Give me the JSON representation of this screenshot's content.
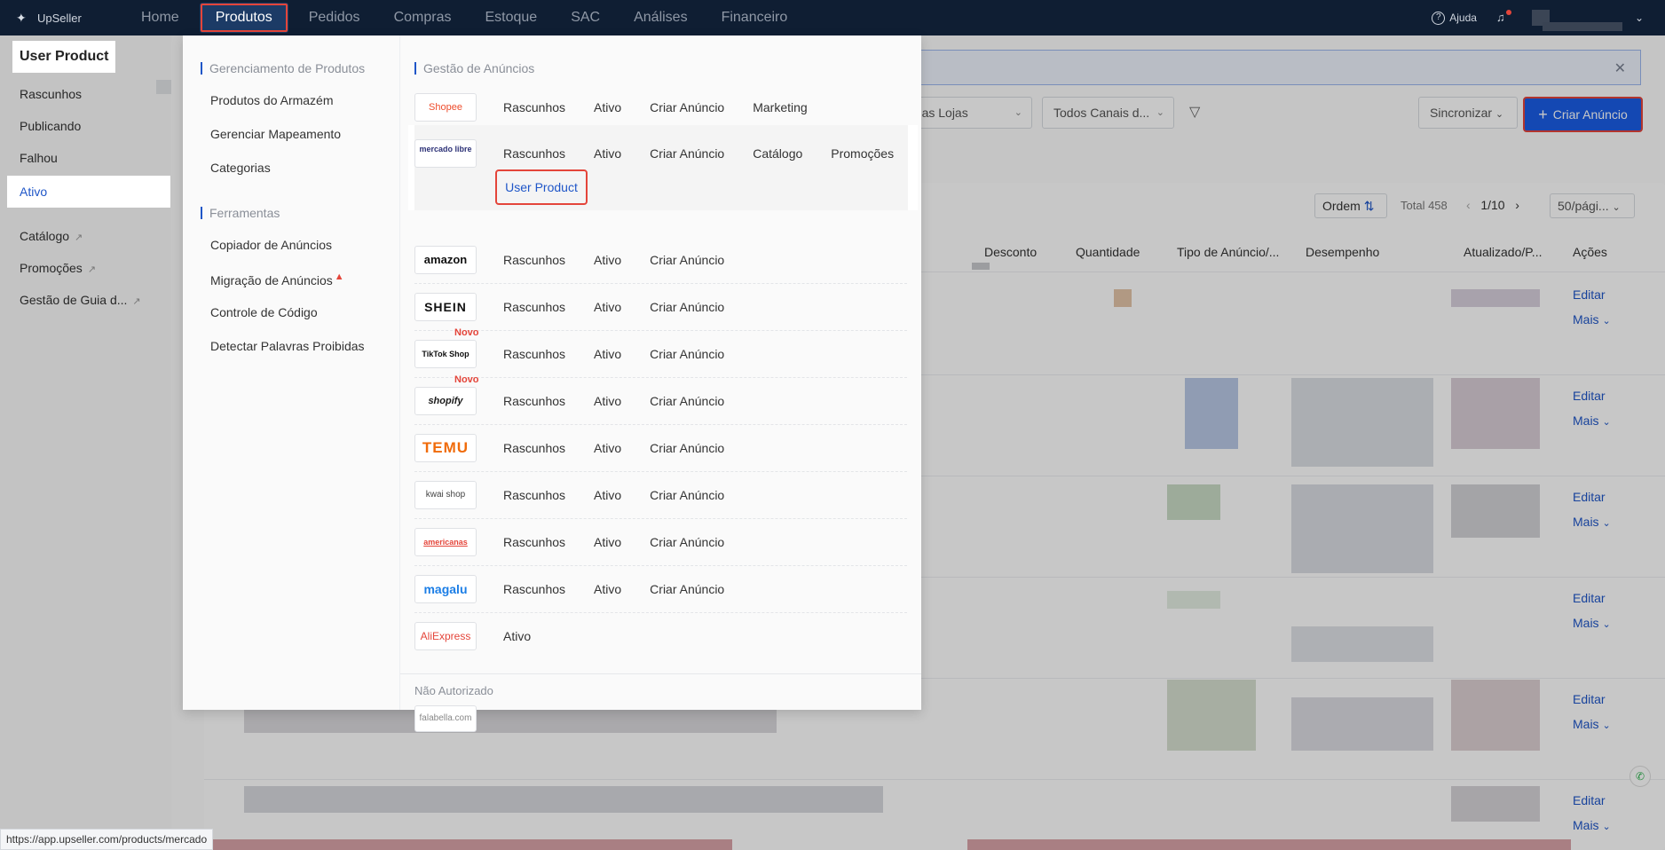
{
  "topbar": {
    "logo": "UpSeller",
    "nav": [
      "Home",
      "Produtos",
      "Pedidos",
      "Compras",
      "Estoque",
      "SAC",
      "Análises",
      "Financeiro"
    ],
    "help": "Ajuda"
  },
  "sidebar": {
    "title": "User Product",
    "items": [
      "Rascunhos",
      "Publicando",
      "Falhou",
      "Ativo"
    ],
    "links": [
      "Catálogo",
      "Promoções",
      "Gestão de Guia d..."
    ]
  },
  "toolbar": {
    "select_store": "odas Lojas",
    "select_channel": "Todos Canais d...",
    "sync": "Sincronizar",
    "create": "Criar Anúncio"
  },
  "list": {
    "order": "Ordem",
    "total": "Total 458",
    "page": "1/10",
    "per_page": "50/pági...",
    "columns": [
      "Desconto",
      "Quantidade",
      "Tipo de Anúncio/...",
      "Desempenho",
      "Atualizado/P...",
      "Ações"
    ],
    "edit": "Editar",
    "more": "Mais"
  },
  "mega": {
    "group1": "Gerenciamento de Produtos",
    "group1_links": [
      "Produtos do Armazém",
      "Gerenciar Mapeamento",
      "Categorias"
    ],
    "group2": "Ferramentas",
    "group2_links": [
      "Copiador de Anúncios",
      "Migração de Anúncios",
      "Controle de Código",
      "Detectar Palavras Proibidas"
    ],
    "right_title": "Gestão de Anúncios",
    "marketplaces": [
      {
        "logo": "Shopee",
        "links": [
          "Rascunhos",
          "Ativo",
          "Criar Anúncio",
          "Marketing"
        ]
      },
      {
        "logo": "mercado libre",
        "links": [
          "Rascunhos",
          "Ativo",
          "Criar Anúncio",
          "Catálogo",
          "Promoções"
        ],
        "extra": "User Product"
      },
      {
        "logo": "amazon",
        "links": [
          "Rascunhos",
          "Ativo",
          "Criar Anúncio"
        ]
      },
      {
        "logo": "SHEIN",
        "links": [
          "Rascunhos",
          "Ativo",
          "Criar Anúncio"
        ]
      },
      {
        "logo": "TikTok Shop",
        "badge": "Novo",
        "links": [
          "Rascunhos",
          "Ativo",
          "Criar Anúncio"
        ]
      },
      {
        "logo": "shopify",
        "badge": "Novo",
        "links": [
          "Rascunhos",
          "Ativo",
          "Criar Anúncio"
        ]
      },
      {
        "logo": "TEMU",
        "links": [
          "Rascunhos",
          "Ativo",
          "Criar Anúncio"
        ]
      },
      {
        "logo": "kwai shop",
        "links": [
          "Rascunhos",
          "Ativo",
          "Criar Anúncio"
        ]
      },
      {
        "logo": "americanas",
        "links": [
          "Rascunhos",
          "Ativo",
          "Criar Anúncio"
        ]
      },
      {
        "logo": "magalu",
        "links": [
          "Rascunhos",
          "Ativo",
          "Criar Anúncio"
        ]
      },
      {
        "logo": "AliExpress",
        "links": [
          "Ativo"
        ]
      }
    ],
    "not_authorized": "Não Autorizado",
    "na_logo": "falabella.com"
  },
  "status_url": "https://app.upseller.com/products/mercado",
  "colors": {
    "accent": "#1a5de6",
    "highlight": "#e4453a",
    "nav_bg": "#0f1e33"
  }
}
